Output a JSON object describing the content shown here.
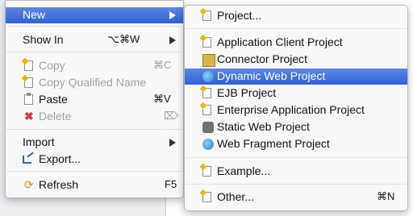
{
  "left_menu": {
    "new": {
      "label": "New"
    },
    "show_in": {
      "label": "Show In",
      "shortcut": "⌥⌘W"
    },
    "copy": {
      "label": "Copy",
      "shortcut": "⌘C"
    },
    "copy_qualified": {
      "label": "Copy Qualified Name"
    },
    "paste": {
      "label": "Paste",
      "shortcut": "⌘V"
    },
    "delete": {
      "label": "Delete",
      "shortcut": "⌦"
    },
    "import": {
      "label": "Import"
    },
    "export": {
      "label": "Export..."
    },
    "refresh": {
      "label": "Refresh",
      "shortcut": "F5"
    }
  },
  "right_menu": {
    "project": {
      "label": "Project..."
    },
    "application_client": {
      "label": "Application Client Project"
    },
    "connector": {
      "label": "Connector Project"
    },
    "dynamic_web": {
      "label": "Dynamic Web Project"
    },
    "ejb": {
      "label": "EJB Project"
    },
    "enterprise_app": {
      "label": "Enterprise Application Project"
    },
    "static_web": {
      "label": "Static Web Project"
    },
    "web_fragment": {
      "label": "Web Fragment Project"
    },
    "example": {
      "label": "Example..."
    },
    "other": {
      "label": "Other...",
      "shortcut": "⌘N"
    }
  },
  "colors": {
    "selection": "#3a6bdb",
    "disabled_text": "#9aa0a6"
  }
}
